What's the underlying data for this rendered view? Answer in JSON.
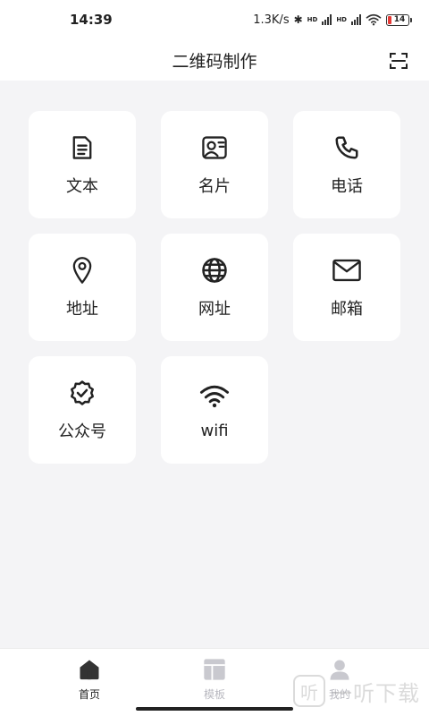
{
  "status_bar": {
    "time": "14:39",
    "network_speed": "1.3K/s",
    "hd1": "HD",
    "hd2": "HD",
    "battery": "14"
  },
  "header": {
    "title": "二维码制作",
    "scan_icon": "scan-icon"
  },
  "cards": [
    {
      "label": "文本",
      "icon": "document-icon"
    },
    {
      "label": "名片",
      "icon": "business-card-icon"
    },
    {
      "label": "电话",
      "icon": "phone-icon"
    },
    {
      "label": "地址",
      "icon": "location-pin-icon"
    },
    {
      "label": "网址",
      "icon": "globe-icon"
    },
    {
      "label": "邮箱",
      "icon": "mail-icon"
    },
    {
      "label": "公众号",
      "icon": "verified-badge-icon"
    },
    {
      "label": "wifi",
      "icon": "wifi-icon"
    }
  ],
  "bottom_nav": [
    {
      "label": "首页",
      "icon": "home-icon",
      "active": true
    },
    {
      "label": "模板",
      "icon": "template-icon",
      "active": false
    },
    {
      "label": "我的",
      "icon": "user-icon",
      "active": false
    }
  ],
  "watermark": {
    "badge": "听",
    "text": "一听下载"
  },
  "colors": {
    "background": "#f4f4f6",
    "card": "#ffffff",
    "text": "#222222",
    "inactive_nav": "#b9b9c0",
    "battery_low": "#e53935"
  }
}
